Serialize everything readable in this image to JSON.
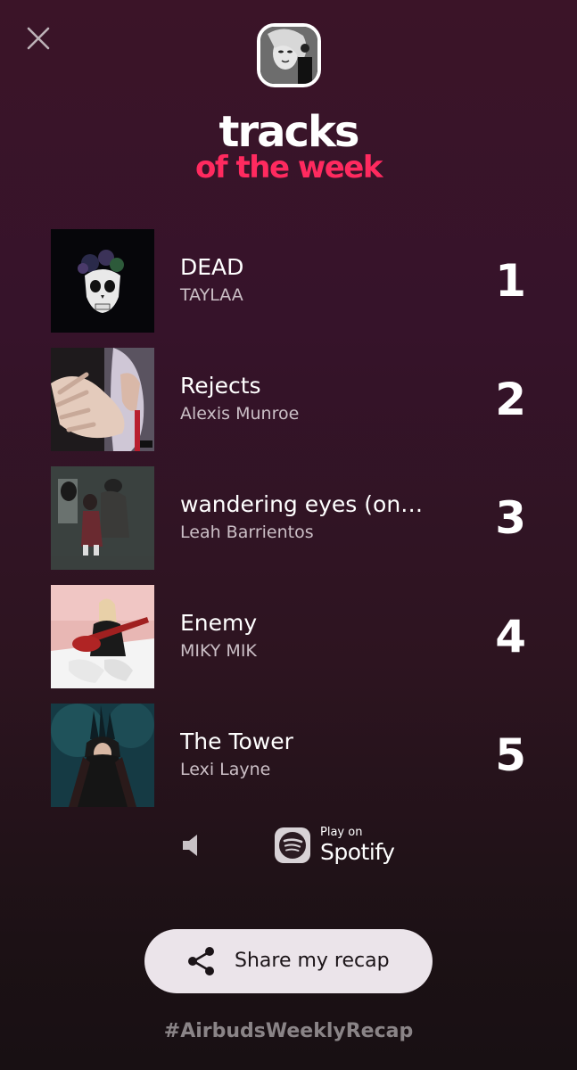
{
  "header": {
    "close_icon": "close-icon",
    "avatar": "profile-avatar",
    "title_line1": "tracks",
    "title_line2": "of the week"
  },
  "tracks": [
    {
      "rank": "1",
      "title": "DEAD",
      "artist": "TAYLAA",
      "cover": "album-cover"
    },
    {
      "rank": "2",
      "title": "Rejects",
      "artist": "Alexis Munroe",
      "cover": "album-cover"
    },
    {
      "rank": "3",
      "title": "wandering eyes (on…",
      "artist": "Leah Barrientos",
      "cover": "album-cover"
    },
    {
      "rank": "4",
      "title": "Enemy",
      "artist": "MIKY MIK",
      "cover": "album-cover"
    },
    {
      "rank": "5",
      "title": "The Tower",
      "artist": "Lexi Layne",
      "cover": "album-cover"
    }
  ],
  "controls": {
    "speaker_icon": "speaker-icon",
    "spotify_small": "Play on",
    "spotify_big": "Spotify"
  },
  "share": {
    "label": "Share my recap",
    "icon": "share-icon"
  },
  "hashtag": "#AirbudsWeeklyRecap",
  "colors": {
    "background_top": "#3b1428",
    "background_bottom": "#181013",
    "accent_pink": "#ff2a5f",
    "button_bg": "#ebe4ea",
    "hashtag": "#8a8487"
  }
}
